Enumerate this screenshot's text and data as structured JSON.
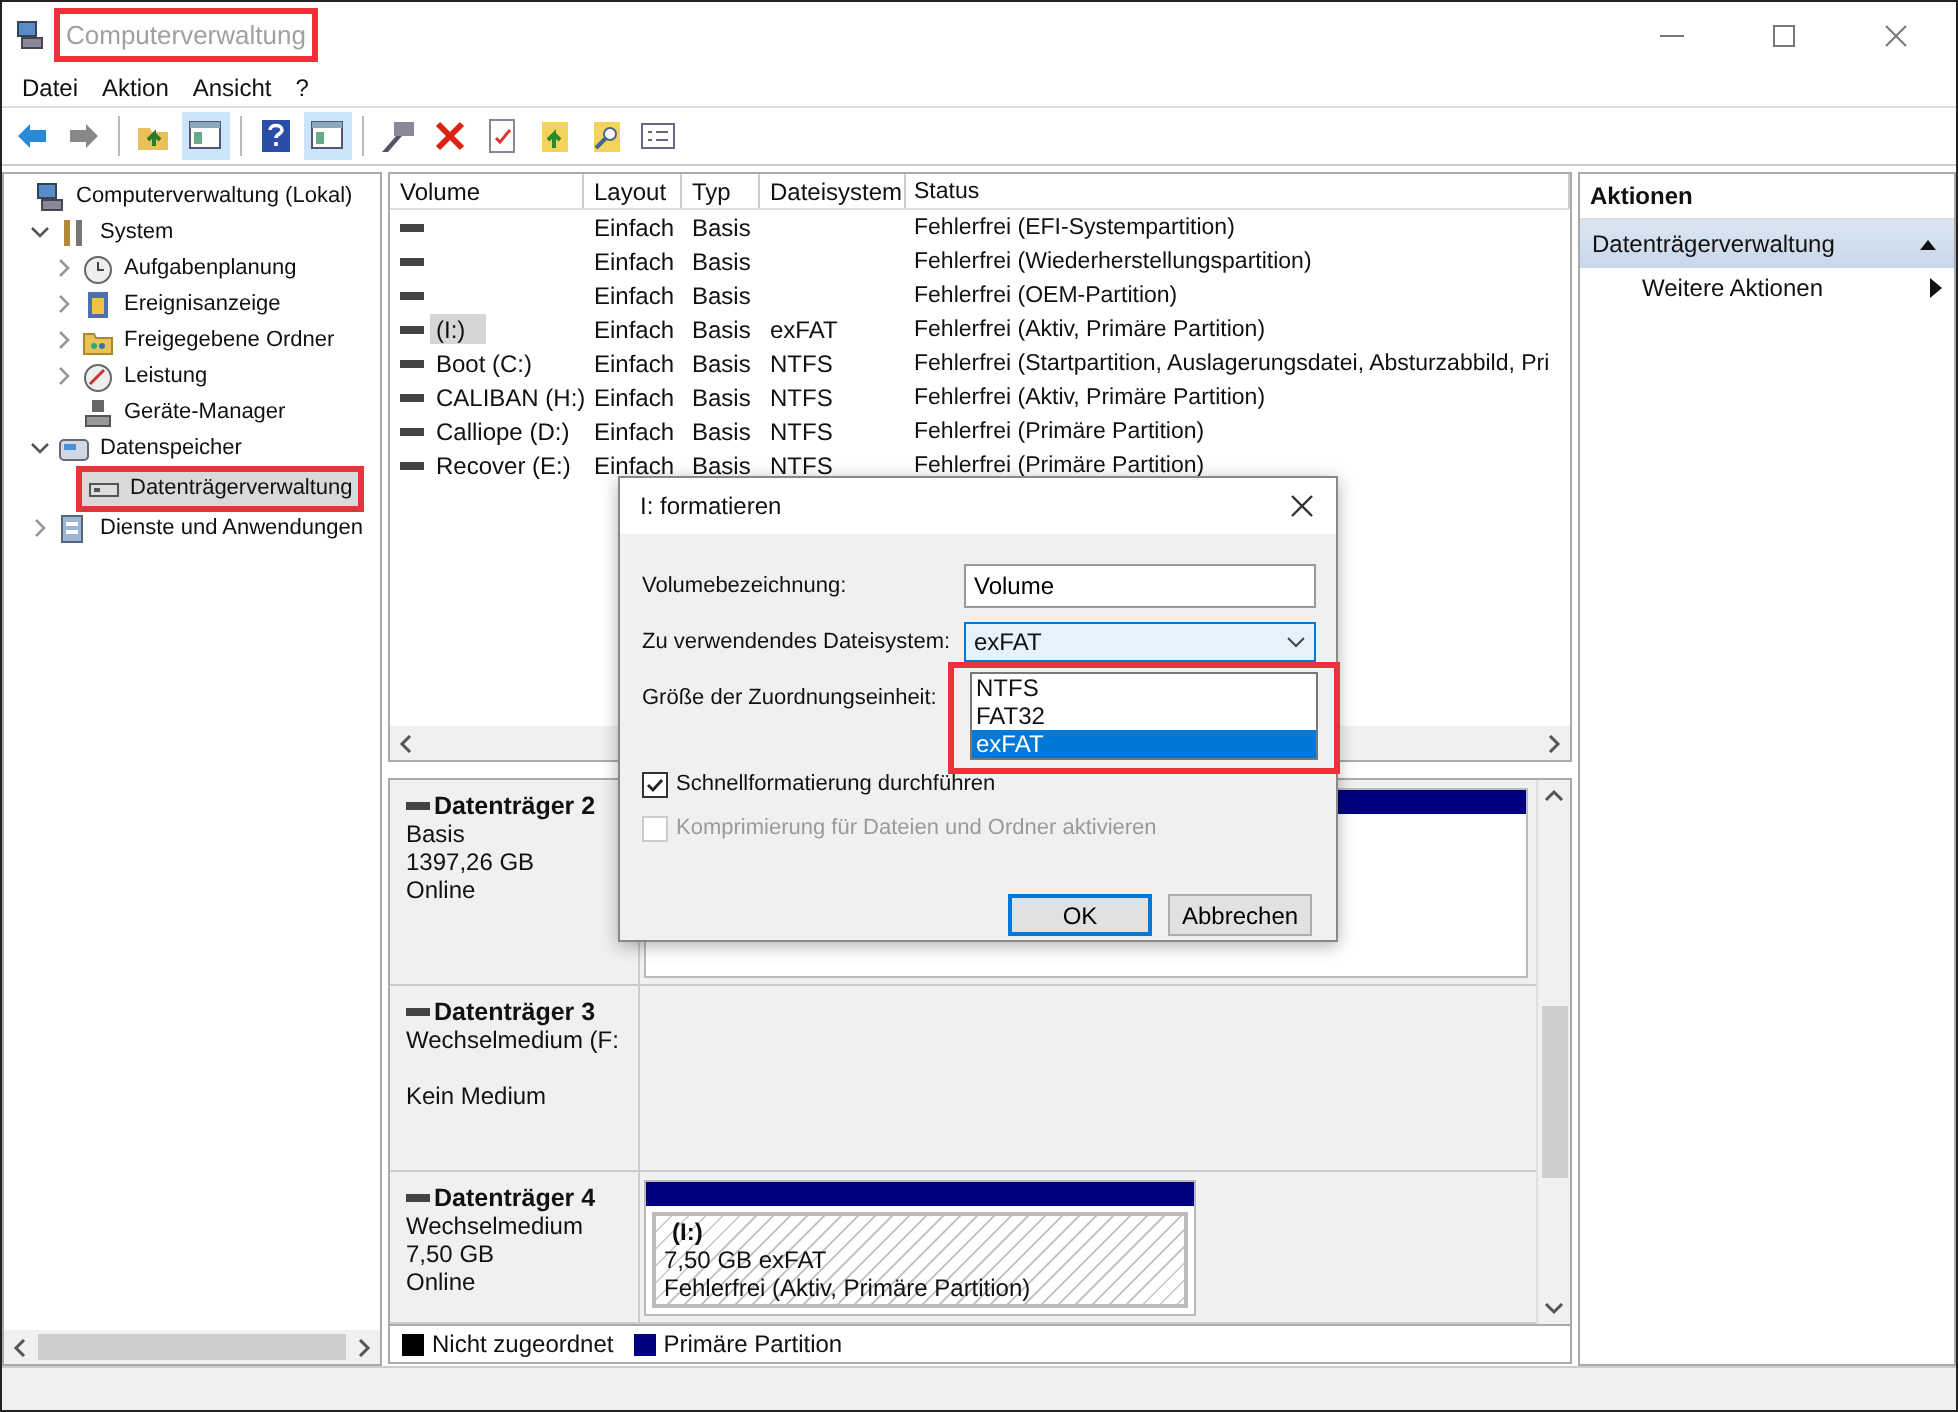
{
  "window": {
    "title": "Computerverwaltung",
    "highlighted": true
  },
  "menu": [
    "Datei",
    "Aktion",
    "Ansicht",
    "?"
  ],
  "toolbar": [
    {
      "kind": "back",
      "on": false
    },
    {
      "kind": "forward",
      "on": false
    },
    {
      "kind": "separator"
    },
    {
      "kind": "up",
      "on": false
    },
    {
      "kind": "pane",
      "on": true
    },
    {
      "kind": "separator"
    },
    {
      "kind": "help",
      "on": false
    },
    {
      "kind": "pane",
      "on": true
    },
    {
      "kind": "separator"
    },
    {
      "kind": "connect",
      "on": false
    },
    {
      "kind": "delete",
      "on": false
    },
    {
      "kind": "check",
      "on": false
    },
    {
      "kind": "folder",
      "on": false
    },
    {
      "kind": "search",
      "on": false
    },
    {
      "kind": "list",
      "on": false
    }
  ],
  "tree": [
    {
      "label": "Computerverwaltung (Lokal)",
      "kind": "computer",
      "selected": false,
      "children": [
        {
          "label": "System",
          "kind": "tools",
          "expanded": true,
          "selected": false,
          "children": [
            {
              "label": "Aufgabenplanung",
              "kind": "clock",
              "expanded": false,
              "selected": false
            },
            {
              "label": "Ereignisanzeige",
              "kind": "log",
              "expanded": false,
              "selected": false
            },
            {
              "label": "Freigegebene Ordner",
              "kind": "folder",
              "expanded": false,
              "selected": false
            },
            {
              "label": "Leistung",
              "kind": "gauge",
              "expanded": false,
              "selected": false
            },
            {
              "label": "Geräte-Manager",
              "kind": "device",
              "selected": false
            }
          ]
        },
        {
          "label": "Datenspeicher",
          "kind": "storage",
          "expanded": true,
          "selected": false,
          "children": [
            {
              "label": "Datenträgerverwaltung",
              "kind": "drive",
              "selected": true,
              "highlighted": true
            }
          ]
        },
        {
          "label": "Dienste und Anwendungen",
          "kind": "services",
          "expanded": false,
          "selected": false
        }
      ]
    }
  ],
  "volumes": {
    "columns": [
      "Volume",
      "Layout",
      "Typ",
      "Dateisystem",
      "Status"
    ],
    "rows": [
      {
        "layout": "Einfach",
        "type": "Basis",
        "status": "Fehlerfrei (EFI-Systempartition)",
        "selected": false
      },
      {
        "layout": "Einfach",
        "type": "Basis",
        "status": "Fehlerfrei (Wiederherstellungspartition)",
        "selected": false
      },
      {
        "layout": "Einfach",
        "type": "Basis",
        "status": "Fehlerfrei (OEM-Partition)",
        "selected": false
      },
      {
        "volume": "(I:)",
        "layout": "Einfach",
        "type": "Basis",
        "file_system": "exFAT",
        "status": "Fehlerfrei (Aktiv, Primäre Partition)",
        "selected": true
      },
      {
        "volume": "Boot (C:)",
        "layout": "Einfach",
        "type": "Basis",
        "file_system": "NTFS",
        "status": "Fehlerfrei (Startpartition, Auslagerungsdatei, Absturzabbild, Pri",
        "selected": false
      },
      {
        "volume": "CALIBAN (H:)",
        "layout": "Einfach",
        "type": "Basis",
        "file_system": "NTFS",
        "status": "Fehlerfrei (Aktiv, Primäre Partition)",
        "selected": false
      },
      {
        "volume": "Calliope (D:)",
        "layout": "Einfach",
        "type": "Basis",
        "file_system": "NTFS",
        "status": "Fehlerfrei (Primäre Partition)",
        "selected": false
      },
      {
        "volume": "Recover (E:)",
        "layout": "Einfach",
        "type": "Basis",
        "file_system": "NTFS",
        "status": "Fehlerfrei (Primäre Partition)",
        "selected": false
      }
    ]
  },
  "disks": [
    {
      "name": "Datenträger 2",
      "type": "Basis",
      "size": "1397,26 GB",
      "status": "Online",
      "partitions": [
        {
          "kind": "primary",
          "selected": false
        }
      ]
    },
    {
      "name": "Datenträger 3",
      "type": "Wechselmedium (F:",
      "status": "Kein Medium"
    },
    {
      "name": "Datenträger 4",
      "type": "Wechselmedium",
      "size": "7,50 GB",
      "status": "Online",
      "partitions": [
        {
          "kind": "primary",
          "selected": true,
          "label": "(I:)",
          "size": "7,50 GB exFAT",
          "status": "Fehlerfrei (Aktiv, Primäre Partition)"
        }
      ]
    }
  ],
  "legend": [
    {
      "label": "Nicht zugeordnet",
      "color": "#000000"
    },
    {
      "label": "Primäre Partition",
      "color": "#000080"
    }
  ],
  "actions": {
    "title": "Aktionen",
    "section": "Datenträgerverwaltung",
    "expanded": true,
    "items": [
      "Weitere Aktionen"
    ]
  },
  "dialog": {
    "title": "I: formatieren",
    "fields": [
      {
        "label": "Volumebezeichnung:",
        "kind": "text",
        "value": "Volume"
      },
      {
        "label": "Zu verwendendes Dateisystem:",
        "kind": "select",
        "value": "exFAT",
        "open": true,
        "highlighted": true,
        "options": [
          {
            "label": "NTFS",
            "selected": false
          },
          {
            "label": "FAT32",
            "selected": false
          },
          {
            "label": "exFAT",
            "selected": true
          }
        ]
      },
      {
        "label": "Größe der Zuordnungseinheit:"
      }
    ],
    "checkboxes": [
      {
        "label": "Schnellformatierung durchführen",
        "checked": true,
        "disabled": false
      },
      {
        "label": "Komprimierung für Dateien und Ordner aktivieren",
        "checked": false,
        "disabled": true
      }
    ],
    "buttons": [
      {
        "label": "OK",
        "default": true
      },
      {
        "label": "Abbrechen",
        "default": false
      }
    ]
  }
}
